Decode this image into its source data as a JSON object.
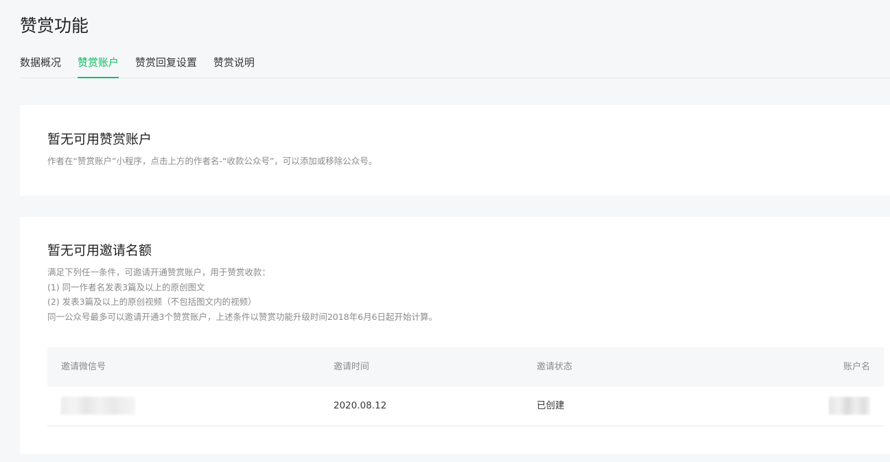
{
  "header": {
    "title": "赞赏功能"
  },
  "tabs": [
    {
      "label": "数据概况",
      "active": false
    },
    {
      "label": "赞赏账户",
      "active": true
    },
    {
      "label": "赞赏回复设置",
      "active": false
    },
    {
      "label": "赞赏说明",
      "active": false
    }
  ],
  "account_card": {
    "title": "暂无可用赞赏账户",
    "description": "作者在“赞赏账户”小程序，点击上方的作者名-“收款公众号”，可以添加或移除公众号。"
  },
  "invite_card": {
    "title": "暂无可用邀请名额",
    "lines": [
      "满足下列任一条件，可邀请开通赞赏账户，用于赞赏收款：",
      "(1) 同一作者名发表3篇及以上的原创图文",
      "(2) 发表3篇及以上的原创视频（不包括图文内的视频）",
      "同一公众号最多可以邀请开通3个赞赏账户，上述条件以赞赏功能升级时间2018年6月6日起开始计算。"
    ],
    "table": {
      "columns": [
        "邀请微信号",
        "邀请时间",
        "邀请状态",
        "账户名"
      ],
      "rows": [
        {
          "wechat_id": "",
          "time": "2020.08.12",
          "status": "已创建",
          "account_name": ""
        }
      ]
    }
  },
  "colors": {
    "accent": "#07c160",
    "background": "#f6f7f9",
    "card": "#ffffff",
    "muted_text": "#8a8a8a"
  }
}
